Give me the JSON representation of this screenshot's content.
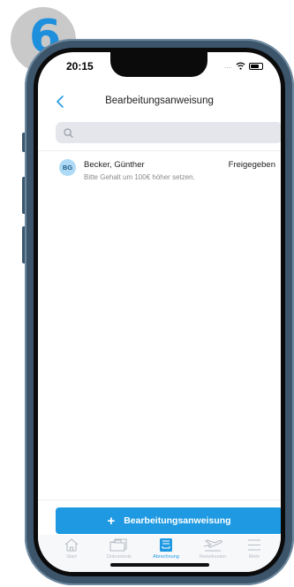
{
  "badge": {
    "step": "6"
  },
  "status_bar": {
    "time": "20:15",
    "signal": "...."
  },
  "header": {
    "title": "Bearbeitungsanweisung"
  },
  "search": {
    "placeholder": "",
    "value": ""
  },
  "list": [
    {
      "initials": "BG",
      "name": "Becker, Günther",
      "status": "Freigegeben",
      "note": "Bitte Gehalt um 100€ höher setzen."
    }
  ],
  "primary_button": {
    "icon": "+",
    "label": "Bearbeitungsanweisung"
  },
  "tabs": [
    {
      "label": "Start",
      "icon": "home-icon",
      "active": false
    },
    {
      "label": "Dokumente",
      "icon": "folder-icon",
      "active": false
    },
    {
      "label": "Abrechnung",
      "icon": "payroll-icon",
      "active": true
    },
    {
      "label": "Reisekosten",
      "icon": "airplane-icon",
      "active": false
    },
    {
      "label": "Mehr",
      "icon": "menu-icon",
      "active": false
    }
  ],
  "colors": {
    "accent": "#1f9ae2",
    "frame": "#3c556b",
    "badge_number": "#1e8fdc"
  }
}
